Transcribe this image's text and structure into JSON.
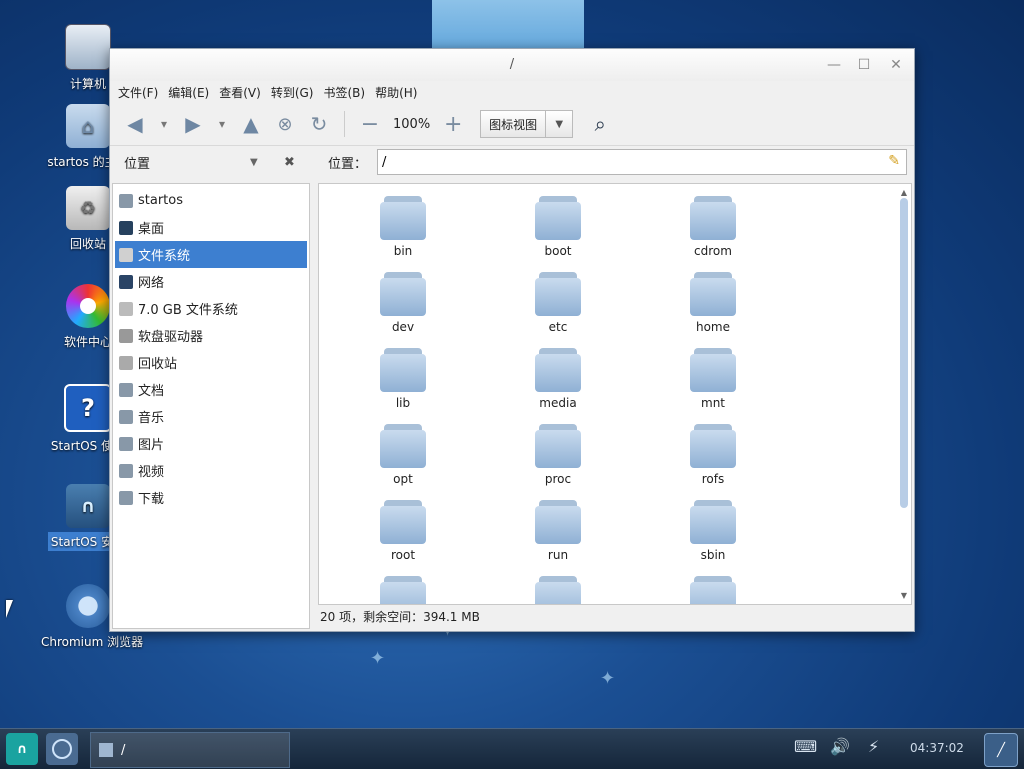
{
  "desktop": {
    "icons": [
      {
        "label": "计算机"
      },
      {
        "label": "startos 的主文"
      },
      {
        "label": "回收站"
      },
      {
        "label": "软件中心"
      },
      {
        "label": "StartOS 使用"
      },
      {
        "label": "StartOS 安装"
      },
      {
        "label": "Chromium 浏览器"
      }
    ]
  },
  "window": {
    "title": "/",
    "menu": [
      "文件(F)",
      "编辑(E)",
      "查看(V)",
      "转到(G)",
      "书签(B)",
      "帮助(H)"
    ],
    "toolbar": {
      "zoom": "100%",
      "view_mode": "图标视图"
    },
    "location": {
      "sidebar_header": "位置",
      "label": "位置：",
      "path": "/"
    },
    "sidebar": {
      "items": [
        {
          "label": "startos",
          "icon": "home-icon"
        },
        {
          "label": "桌面",
          "icon": "desktop-icon"
        },
        {
          "label": "文件系统",
          "icon": "drive-icon",
          "selected": true
        },
        {
          "label": "网络",
          "icon": "network-icon"
        },
        {
          "label": "7.0 GB 文件系统",
          "icon": "drive-icon"
        },
        {
          "label": "软盘驱动器",
          "icon": "floppy-icon"
        },
        {
          "label": "回收站",
          "icon": "trash-icon"
        },
        {
          "label": "文档",
          "icon": "folder-icon"
        },
        {
          "label": "音乐",
          "icon": "folder-icon"
        },
        {
          "label": "图片",
          "icon": "folder-icon"
        },
        {
          "label": "视频",
          "icon": "folder-icon"
        },
        {
          "label": "下载",
          "icon": "folder-icon"
        }
      ]
    },
    "folders": [
      "bin",
      "boot",
      "cdrom",
      "dev",
      "etc",
      "home",
      "lib",
      "media",
      "mnt",
      "opt",
      "proc",
      "rofs",
      "root",
      "run",
      "sbin",
      "",
      "",
      ""
    ],
    "status": "20 项，剩余空间：394.1 MB"
  },
  "taskbar": {
    "task_label": "/",
    "clock": "04:37:02"
  },
  "colors": {
    "selection": "#3d7fd0",
    "desktop": "#1b4f93"
  }
}
